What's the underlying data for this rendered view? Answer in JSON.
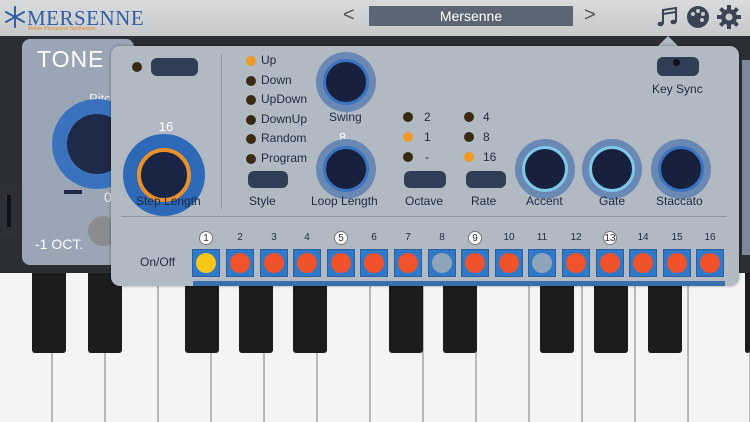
{
  "app": {
    "logo_text": "MERSENNE",
    "logo_subtitle": "Mobile Percussive Synthesizer"
  },
  "header": {
    "preset_name": "Mersenne",
    "prev_label": "<",
    "next_label": ">",
    "icons": [
      "music-notes-icon",
      "palette-icon",
      "gear-icon"
    ]
  },
  "tone_panel": {
    "title": "TONE",
    "pitch_label": "Pitch",
    "pitch_value": "0",
    "octave_label": "-1 OCT."
  },
  "arp": {
    "step_length": {
      "label": "Step Length",
      "value": "16"
    },
    "style": {
      "label": "Style",
      "options": [
        "Up",
        "Down",
        "UpDown",
        "DownUp",
        "Random",
        "Program"
      ],
      "selected": "Up"
    },
    "swing": {
      "label": "Swing"
    },
    "loop_length": {
      "label": "Loop Length",
      "value": "8"
    },
    "octave": {
      "label": "Octave",
      "options": [
        "2",
        "1",
        "-"
      ],
      "selected": "1"
    },
    "rate": {
      "label": "Rate",
      "options": [
        "4",
        "8",
        "16"
      ],
      "selected": "16"
    },
    "accent": {
      "label": "Accent"
    },
    "gate": {
      "label": "Gate"
    },
    "staccato": {
      "label": "Staccato"
    },
    "key_sync": {
      "label": "Key Sync"
    },
    "steps": {
      "row_label": "On/Off",
      "numbers": [
        "1",
        "2",
        "3",
        "4",
        "5",
        "6",
        "7",
        "8",
        "9",
        "10",
        "11",
        "12",
        "13",
        "14",
        "15",
        "16"
      ],
      "states": [
        "current",
        "on",
        "on",
        "on",
        "on",
        "on",
        "on",
        "off",
        "on",
        "on",
        "off",
        "on",
        "on",
        "on",
        "on",
        "on"
      ]
    }
  },
  "colors": {
    "accent": "#f09a24",
    "step_on": "#f0522b",
    "step_current": "#f5c518",
    "knob_ring": "#2e69b8",
    "panel": "#b1b9c3"
  }
}
